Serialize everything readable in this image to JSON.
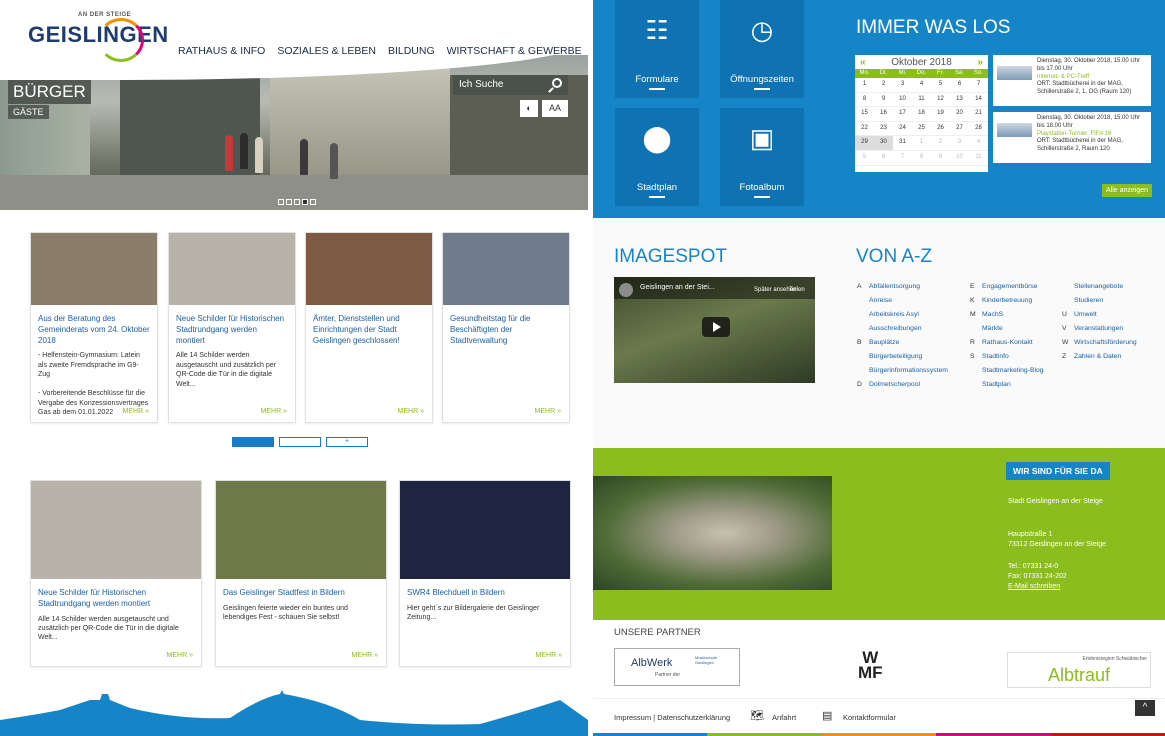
{
  "header": {
    "logo_small": "AN DER STEIGE",
    "logo": "GEISLINGEN",
    "nav": [
      "RATHAUS & INFO",
      "SOZIALES & LEBEN",
      "BILDUNG",
      "WIRTSCHAFT & GEWERBE"
    ],
    "hero_big": "BÜRGER",
    "hero_small": "GÄSTE",
    "search_placeholder": "Ich Suche",
    "contrast_icon": "contrast-icon",
    "font_size_label": "AA"
  },
  "news1": [
    {
      "title": "Aus der Beratung des Gemeinderats vom 24. Oktober 2018",
      "text": "- Helfenstein-Gymnasium: Latein als zweite Fremdsprache im G9-Zug\n\n- Vorbereitende Beschlüsse für die Vergabe des Konzessionsvertrages Gas ab dem 01.01.2022",
      "more": "MEHR »",
      "color": "#8a7d6a"
    },
    {
      "title": "Neue Schilder für Historischen Stadtrundgang werden montiert",
      "text": "Alle 14 Schilder werden ausgetauscht und zusätzlich per QR-Code die Tür in die digitale Welt...",
      "more": "MEHR »",
      "color": "#b8b3a8"
    },
    {
      "title": "Ämter, Dienststellen und Einrichtungen der Stadt Geislingen geschlossen!",
      "text": "",
      "more": "MEHR »",
      "color": "#7e5a43"
    },
    {
      "title": "Gesundheitstag für die Beschäftigten der Stadtverwaltung",
      "text": "",
      "more": "MEHR »",
      "color": "#6f7b8a"
    }
  ],
  "pager_plus": "+",
  "news2": [
    {
      "title": "Neue Schilder für Historischen Stadtrundgang werden montiert",
      "text": "Alle 14 Schilder werden ausgetauscht und zusätzlich per QR-Code die Tür in die digitale Welt...",
      "more": "MEHR »",
      "color": "#b8b3a8"
    },
    {
      "title": "Das Geislinger Stadtfest in Bildern",
      "text": "Geislingen feierte wieder ein buntes und lebendiges Fest - schauen Sie selbst!",
      "more": "MEHR »",
      "color": "#6e7a4a"
    },
    {
      "title": "SWR4 Blechduell in Bildern",
      "text": "Hier geht´s zur Bildergalerie der Geislinger Zeitung...",
      "more": "MEHR »",
      "color": "#1d2540"
    }
  ],
  "tiles": [
    {
      "label": "Formulare",
      "icon": "form-icon"
    },
    {
      "label": "Öffnungszeiten",
      "icon": "clock-icon"
    },
    {
      "label": "Stadtplan",
      "icon": "map-pin-icon"
    },
    {
      "label": "Fotoalbum",
      "icon": "photo-icon"
    }
  ],
  "events": {
    "title": "IMMER WAS LOS",
    "month": "Oktober 2018",
    "prev": "«",
    "next": "»",
    "weekdays": [
      "Mo.",
      "Di.",
      "Mi.",
      "Do.",
      "Fr.",
      "Sa.",
      "So."
    ],
    "weeks": [
      [
        "1",
        "2",
        "3",
        "4",
        "5",
        "6",
        "7"
      ],
      [
        "8",
        "9",
        "10",
        "11",
        "12",
        "13",
        "14"
      ],
      [
        "15",
        "16",
        "17",
        "18",
        "19",
        "20",
        "21"
      ],
      [
        "22",
        "23",
        "24",
        "25",
        "26",
        "27",
        "28"
      ],
      [
        "29",
        "30",
        "31",
        "1",
        "2",
        "3",
        "4"
      ],
      [
        "5",
        "6",
        "7",
        "8",
        "9",
        "10",
        "11"
      ]
    ],
    "items": [
      {
        "date": "Dienstag, 30. Oktober 2018, 15.00 Uhr bis 17.00 Uhr",
        "title": "Internet- & PC-Treff",
        "place": "ORT: Stadtbücherei in der MAG, Schillerstraße 2, 1. OG (Raum 120)"
      },
      {
        "date": "Dienstag, 30. Oktober 2018, 15.00 Uhr bis 18.00 Uhr",
        "title": "Playstation-Turnier: FIFA 19",
        "place": "ORT: Stadtbücherei in der MAG, Schillerstraße 2, Raum 120"
      }
    ],
    "all": "Alle anzeigen"
  },
  "imagespot": {
    "title": "IMAGESPOT",
    "video_title": "Geislingen an der Stei...",
    "later": "Später ansehen",
    "share": "Teilen"
  },
  "az": {
    "title": "VON A-Z",
    "col1": [
      [
        "A",
        "Abfallentsorgung"
      ],
      [
        "",
        "Anreise"
      ],
      [
        "",
        "Arbeitskreis Asyl"
      ],
      [
        "",
        "Ausschreibungen"
      ],
      [
        "B",
        "Bauplätze"
      ],
      [
        "",
        "Bürgerbeteiligung"
      ],
      [
        "",
        "Bürgerinformationssystem"
      ],
      [
        "D",
        "Dolmetscherpool"
      ]
    ],
    "col2": [
      [
        "E",
        "Engagementbörse"
      ],
      [
        "K",
        "Kinderbetreuung"
      ],
      [
        "M",
        "MachS"
      ],
      [
        "",
        "Märkte"
      ],
      [
        "R",
        "Rathaus-Kontakt"
      ],
      [
        "S",
        "Stadtinfo"
      ],
      [
        "",
        "Stadtmarketing-Blog"
      ],
      [
        "",
        "Stadtplan"
      ]
    ],
    "col3": [
      [
        "",
        "Stellenangebote"
      ],
      [
        "",
        "Studieren"
      ],
      [
        "U",
        "Umwelt"
      ],
      [
        "V",
        "Veranstaltungen"
      ],
      [
        "W",
        "Wirtschaftsförderung"
      ],
      [
        "Z",
        "Zahlen & Daten"
      ]
    ]
  },
  "contact": {
    "title": "WIR SIND FÜR SIE DA",
    "org": "Stadt Geislingen an der Steige",
    "street": "Hauptstraße 1",
    "city": "73312 Geislingen an der Steige",
    "tel": "Tel.: 07331 24-0",
    "fax": "Fax: 07331 24-202",
    "mail": "E-Mail schreiben"
  },
  "partners": {
    "title": "UNSERE PARTNER",
    "albwerk": "AlbWerk",
    "albwerk_sub": "Partner der",
    "musik": "Musikschule Geislingen",
    "wmf": "W\nMF",
    "albtrauf": "Albtrauf",
    "albtrauf_region": "Erlebnisregion Schwäbischer"
  },
  "footer": {
    "impressum": "Impressum | Datenschutzerklärung",
    "anfahrt": "Anfahrt",
    "kontakt": "Kontaktformular",
    "top": "^"
  },
  "colors": {
    "blue": "#1585c7",
    "green": "#8cbd1e",
    "navy": "#1f3c6e"
  }
}
